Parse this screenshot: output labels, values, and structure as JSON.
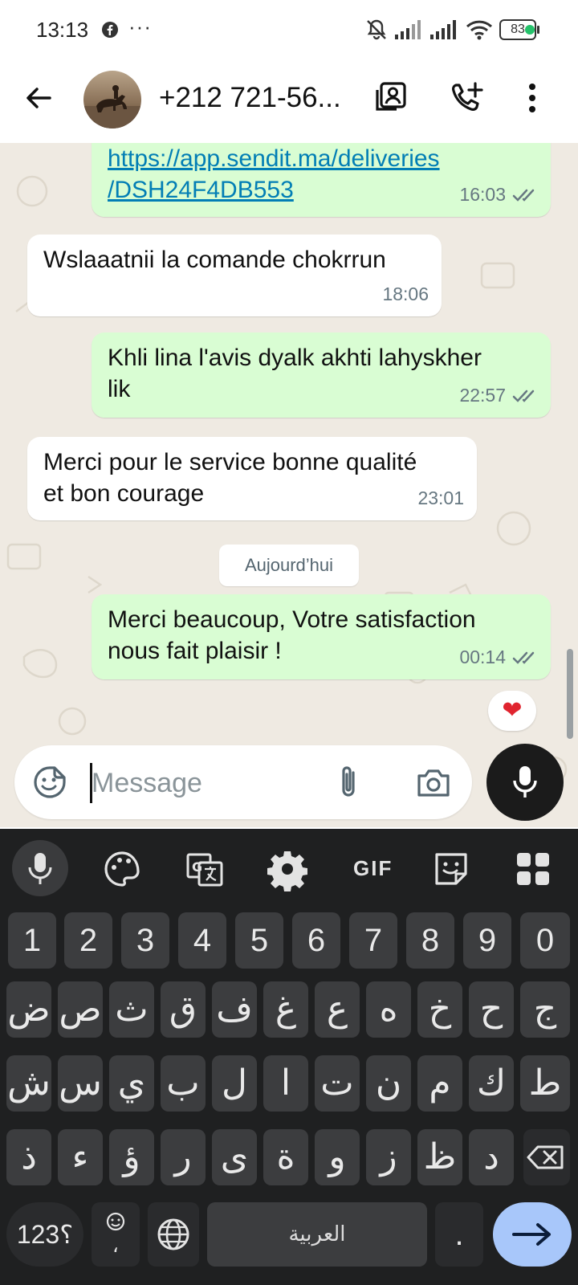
{
  "status_bar": {
    "time": "13:13",
    "overflow": "···",
    "battery": "83"
  },
  "header": {
    "contact": "+212 721-56..."
  },
  "messages": [
    {
      "side": "out",
      "text_line1": "https://app.sendit.ma/deliveries",
      "text_line2": "/DSH24F4DB553",
      "time": "16:03"
    },
    {
      "side": "in",
      "text": "Wslaaatnii la comande chokrrun",
      "time": "18:06"
    },
    {
      "side": "out",
      "text_line1": "Khli lina l'avis dyalk akhti lahyskher",
      "text_line2": "lik",
      "time": "22:57"
    },
    {
      "side": "in",
      "text_line1": "Merci pour le service bonne qualité",
      "text_line2": "et bon courage",
      "time": "23:01"
    },
    {
      "side": "out",
      "text_line1": "Merci beaucoup, Votre satisfaction",
      "text_line2": "nous fait plaisir !",
      "time": "00:14",
      "reaction": "❤"
    }
  ],
  "date_separator": "Aujourd’hui",
  "composer": {
    "placeholder": "Message"
  },
  "keyboard": {
    "toolbar_gif": "GIF",
    "numbers": [
      "1",
      "2",
      "3",
      "4",
      "5",
      "6",
      "7",
      "8",
      "9",
      "0"
    ],
    "row1": [
      "ض",
      "ص",
      "ث",
      "ق",
      "ف",
      "غ",
      "ع",
      "ه",
      "خ",
      "ح",
      "ج"
    ],
    "row2": [
      "ش",
      "س",
      "ي",
      "ب",
      "ل",
      "ا",
      "ت",
      "ن",
      "م",
      "ك",
      "ط"
    ],
    "row3": [
      "ذ",
      "ء",
      "ؤ",
      "ر",
      "ى",
      "ة",
      "و",
      "ز",
      "ظ",
      "د"
    ],
    "symbols_key": "؟123",
    "emoji_key_sub": "،",
    "space_label": "العربية",
    "dot_key": "."
  },
  "colors": {
    "outgoing_bubble": "#d9fdd3",
    "incoming_bubble": "#ffffff",
    "chat_bg": "#efeae2",
    "tick": "#667781",
    "enter_key": "#a8c7fa"
  }
}
